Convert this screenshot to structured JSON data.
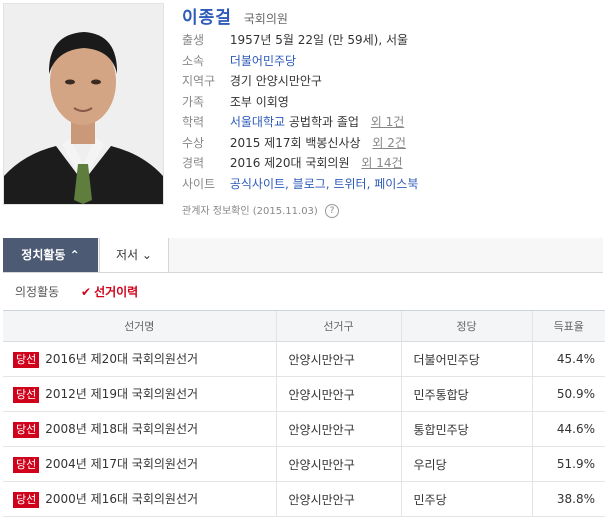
{
  "profile": {
    "name": "이종걸",
    "position": "국회의원",
    "info": [
      {
        "label": "출생",
        "value": "1957년 5월 22일 (만 59세), 서울"
      },
      {
        "label": "소속",
        "link": "더불어민주당"
      },
      {
        "label": "지역구",
        "value": "경기 안양시만안구"
      },
      {
        "label": "가족",
        "value": "조부 이회영"
      },
      {
        "label": "학력",
        "link": "서울대학교",
        "value": "공법학과 졸업",
        "more": "외 1건"
      },
      {
        "label": "수상",
        "value": "2015 제17회 백봉신사상",
        "more": "외 2건"
      },
      {
        "label": "경력",
        "value": "2016 제20대 국회의원",
        "more": "외 14건"
      },
      {
        "label": "사이트",
        "links": [
          "공식사이트",
          "블로그",
          "트위터",
          "페이스북"
        ]
      }
    ],
    "verified": "관계자 정보확인 (2015.11.03)"
  },
  "tabs": {
    "active": "정치활동",
    "inactive": "저서"
  },
  "subtabs": {
    "first": "의정활동",
    "second": "선거이력"
  },
  "table": {
    "headers": [
      "선거명",
      "선거구",
      "정당",
      "득표율"
    ],
    "rows": [
      {
        "badge": "당선",
        "election": "2016년 제20대 국회의원선거",
        "region": "안양시만안구",
        "party": "더불어민주당",
        "pct": "45.4%"
      },
      {
        "badge": "당선",
        "election": "2012년 제19대 국회의원선거",
        "region": "안양시만안구",
        "party": "민주통합당",
        "pct": "50.9%"
      },
      {
        "badge": "당선",
        "election": "2008년 제18대 국회의원선거",
        "region": "안양시만안구",
        "party": "통합민주당",
        "pct": "44.6%"
      },
      {
        "badge": "당선",
        "election": "2004년 제17대 국회의원선거",
        "region": "안양시만안구",
        "party": "우리당",
        "pct": "51.9%"
      },
      {
        "badge": "당선",
        "election": "2000년 제16대 국회의원선거",
        "region": "안양시만안구",
        "party": "민주당",
        "pct": "38.8%"
      }
    ]
  },
  "colors": {
    "link": "#2d5bb9",
    "accent": "#d0021b",
    "tab_active": "#4c5a74"
  }
}
